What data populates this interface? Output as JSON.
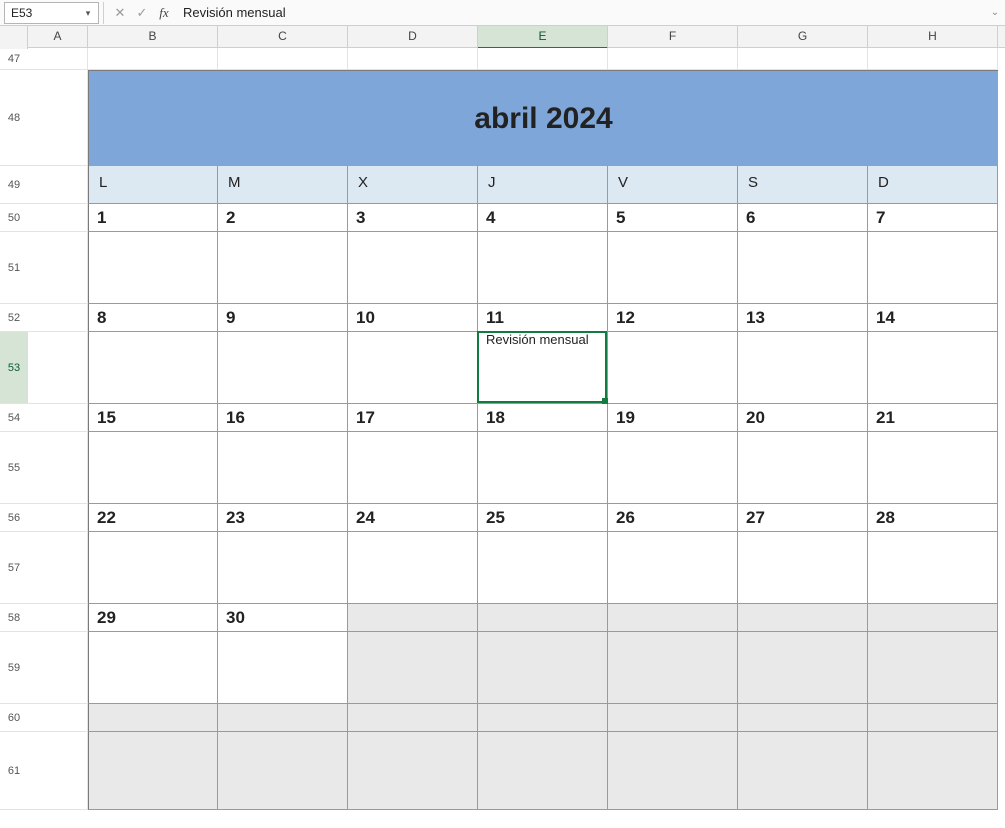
{
  "formula_bar": {
    "cell_ref": "E53",
    "value": "Revisión mensual"
  },
  "columns": [
    "A",
    "B",
    "C",
    "D",
    "E",
    "F",
    "G",
    "H"
  ],
  "active_col": "E",
  "rows": [
    "47",
    "48",
    "49",
    "50",
    "51",
    "52",
    "53",
    "54",
    "55",
    "56",
    "57",
    "58",
    "59",
    "60",
    "61"
  ],
  "active_row": "53",
  "calendar": {
    "title": "abril 2024",
    "dow": [
      "L",
      "M",
      "X",
      "J",
      "V",
      "S",
      "D"
    ],
    "weeks": [
      {
        "days": [
          "1",
          "2",
          "3",
          "4",
          "5",
          "6",
          "7"
        ],
        "events": [
          "",
          "",
          "",
          "",
          "",
          "",
          ""
        ]
      },
      {
        "days": [
          "8",
          "9",
          "10",
          "11",
          "12",
          "13",
          "14"
        ],
        "events": [
          "",
          "",
          "",
          "Revisión mensual",
          "",
          "",
          ""
        ]
      },
      {
        "days": [
          "15",
          "16",
          "17",
          "18",
          "19",
          "20",
          "21"
        ],
        "events": [
          "",
          "",
          "",
          "",
          "",
          "",
          ""
        ]
      },
      {
        "days": [
          "22",
          "23",
          "24",
          "25",
          "26",
          "27",
          "28"
        ],
        "events": [
          "",
          "",
          "",
          "",
          "",
          "",
          ""
        ]
      },
      {
        "days": [
          "29",
          "30",
          "",
          "",
          "",
          "",
          ""
        ],
        "events": [
          "",
          "",
          "",
          "",
          "",
          "",
          ""
        ]
      },
      {
        "days": [
          "",
          "",
          "",
          "",
          "",
          "",
          ""
        ],
        "events": [
          "",
          "",
          "",
          "",
          "",
          "",
          ""
        ]
      }
    ]
  }
}
